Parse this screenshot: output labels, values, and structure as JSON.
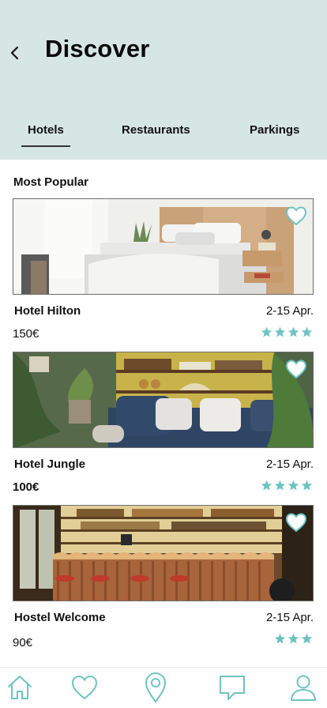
{
  "header": {
    "title": "Discover",
    "back_icon": "chevron-left-icon",
    "background": "#d6e6e4"
  },
  "tabs": [
    {
      "label": "Hotels",
      "active": true
    },
    {
      "label": "Restaurants",
      "active": false
    },
    {
      "label": "Parkings",
      "active": false
    }
  ],
  "section": {
    "title": "Most Popular"
  },
  "hotels": [
    {
      "name": "Hotel Hilton",
      "dates": "2-15 Apr.",
      "price": "150€",
      "rating": 4,
      "photo": "hotel-bedroom-photo"
    },
    {
      "name": "Hotel Jungle",
      "dates": "2-15 Apr.",
      "price": "100€",
      "rating": 4,
      "photo": "hotel-lounge-photo"
    },
    {
      "name": "Hostel Welcome",
      "dates": "2-15 Apr.",
      "price": "90€",
      "rating": 3,
      "photo": "hostel-bar-photo"
    }
  ],
  "bottom_nav": [
    {
      "icon": "home-icon"
    },
    {
      "icon": "heart-icon"
    },
    {
      "icon": "map-pin-icon"
    },
    {
      "icon": "chat-icon"
    },
    {
      "icon": "user-icon"
    }
  ],
  "colors": {
    "accent": "#6fc3c1",
    "star": "#6fc3c1"
  }
}
